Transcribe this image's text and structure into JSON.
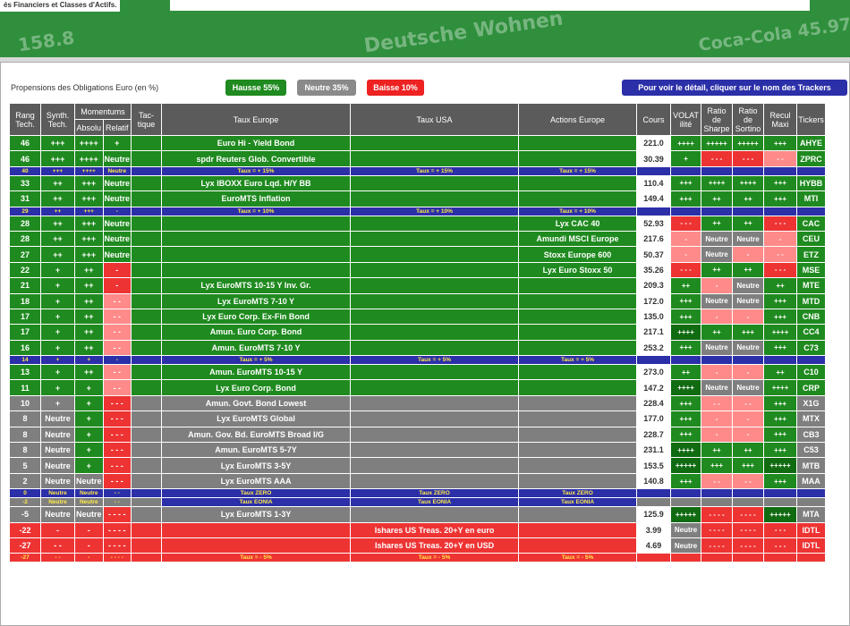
{
  "banner": {
    "subtitle": "és Financiers et Classes d'Actifs.",
    "ghost_items": [
      "Deutsche Wohnen",
      "Coca-Cola 45.97",
      "158.8"
    ]
  },
  "toolbar": {
    "title": "Propensions des Obligations Euro (en %)",
    "hausse": "Hausse 55%",
    "neutre": "Neutre 35%",
    "baisse": "Baisse 10%",
    "detail": "Pour voir le détail, cliquer sur le nom des Trackers"
  },
  "colors": {
    "g": "#1f8a1f",
    "gray": "#7f7f7f",
    "red": "#ee3333",
    "blue": "#2b2fa8",
    "header": "#5b5b5b"
  },
  "headers": {
    "rang": "Rang Tech.",
    "synth": "Synth. Tech.",
    "momentums": "Momentums",
    "absolu": "Absolu",
    "relatif": "Relatif",
    "tactique": "Tac- tique",
    "taux_europe": "Taux Europe",
    "taux_usa": "Taux USA",
    "actions": "Actions Europe",
    "cours": "Cours",
    "volat": "VOLAT ilité",
    "sharpe": "Ratio de Sharpe",
    "sortino": "Ratio de Sortino",
    "recul": "Recul Maxi",
    "tickers": "Tickers"
  },
  "rows": [
    {
      "c": [
        "46",
        "+++",
        "++++",
        "+",
        "",
        "Euro Hi - Yield Bond",
        "",
        "",
        "221.0",
        "++++",
        "+++++",
        "+++++",
        "+++",
        "AHYE"
      ],
      "k": [
        "g",
        "g",
        "g",
        "g",
        "g",
        "g",
        "g",
        "g",
        "w",
        "g",
        "g",
        "g",
        "g",
        "g"
      ]
    },
    {
      "c": [
        "46",
        "+++",
        "++++",
        "Neutre",
        "",
        "spdr Reuters Glob. Convertible",
        "",
        "",
        "30.39",
        "+",
        "- - -",
        "- - -",
        "- -",
        "ZPRC"
      ],
      "k": [
        "g",
        "g",
        "g",
        "g",
        "g",
        "g",
        "g",
        "g",
        "w",
        "g",
        "r",
        "r",
        "pr",
        "g"
      ]
    },
    {
      "s": 1,
      "c": [
        "40",
        "+++",
        "++++",
        "Neutre",
        "",
        "Taux = + 15%",
        "Taux = + 15%",
        "Taux = + 15%",
        "",
        "",
        "",
        "",
        "",
        ""
      ]
    },
    {
      "c": [
        "33",
        "++",
        "+++",
        "Neutre",
        "",
        "Lyx IBOXX Euro Lqd. H/Y BB",
        "",
        "",
        "110.4",
        "+++",
        "++++",
        "++++",
        "+++",
        "HYBB"
      ],
      "k": [
        "g",
        "g",
        "g",
        "g",
        "g",
        "g",
        "g",
        "g",
        "w",
        "g",
        "g",
        "g",
        "g",
        "g"
      ]
    },
    {
      "c": [
        "31",
        "++",
        "+++",
        "Neutre",
        "",
        "EuroMTS Inflation",
        "",
        "",
        "149.4",
        "+++",
        "++",
        "++",
        "+++",
        "MTI"
      ],
      "k": [
        "g",
        "g",
        "g",
        "g",
        "g",
        "g",
        "g",
        "g",
        "w",
        "g",
        "g",
        "g",
        "g",
        "g"
      ]
    },
    {
      "s": 1,
      "c": [
        "29",
        "++",
        "+++",
        "-",
        "",
        "Taux = + 10%",
        "Taux = + 10%",
        "Taux = + 10%",
        "",
        "",
        "",
        "",
        "",
        ""
      ]
    },
    {
      "c": [
        "28",
        "++",
        "+++",
        "Neutre",
        "",
        "",
        "",
        "Lyx CAC 40",
        "52.93",
        "- - -",
        "++",
        "++",
        "- - -",
        "CAC"
      ],
      "k": [
        "g",
        "g",
        "g",
        "g",
        "g",
        "g",
        "g",
        "g",
        "w",
        "r",
        "g",
        "g",
        "r",
        "g"
      ]
    },
    {
      "c": [
        "28",
        "++",
        "+++",
        "Neutre",
        "",
        "",
        "",
        "Amundi MSCI Europe",
        "217.6",
        "-",
        "Neutre",
        "Neutre",
        "-",
        "CEU"
      ],
      "k": [
        "g",
        "g",
        "g",
        "g",
        "g",
        "g",
        "g",
        "g",
        "w",
        "pr",
        "gr",
        "gr",
        "pr",
        "g"
      ]
    },
    {
      "c": [
        "27",
        "++",
        "+++",
        "Neutre",
        "",
        "",
        "",
        "Stoxx Europe 600",
        "50.37",
        "-",
        "Neutre",
        "-",
        "- -",
        "ETZ"
      ],
      "k": [
        "g",
        "g",
        "g",
        "g",
        "g",
        "g",
        "g",
        "g",
        "w",
        "pr",
        "gr",
        "pr",
        "pr",
        "g"
      ]
    },
    {
      "c": [
        "22",
        "+",
        "++",
        "-",
        "",
        "",
        "",
        "Lyx Euro Stoxx 50",
        "35.26",
        "- - -",
        "++",
        "++",
        "- - -",
        "MSE"
      ],
      "k": [
        "g",
        "g",
        "g",
        "r",
        "g",
        "g",
        "g",
        "g",
        "w",
        "r",
        "g",
        "g",
        "r",
        "g"
      ]
    },
    {
      "c": [
        "21",
        "+",
        "++",
        "-",
        "",
        "Lyx EuroMTS 10-15 Y Inv. Gr.",
        "",
        "",
        "209.3",
        "++",
        "-",
        "Neutre",
        "++",
        "MTE"
      ],
      "k": [
        "g",
        "g",
        "g",
        "r",
        "g",
        "g",
        "g",
        "g",
        "w",
        "g",
        "pr",
        "gr",
        "g",
        "g"
      ]
    },
    {
      "c": [
        "18",
        "+",
        "++",
        "- -",
        "",
        "Lyx EuroMTS 7-10 Y",
        "",
        "",
        "172.0",
        "+++",
        "Neutre",
        "Neutre",
        "+++",
        "MTD"
      ],
      "k": [
        "g",
        "g",
        "g",
        "pr",
        "g",
        "g",
        "g",
        "g",
        "w",
        "g",
        "gr",
        "gr",
        "g",
        "g"
      ]
    },
    {
      "c": [
        "17",
        "+",
        "++",
        "- -",
        "",
        "Lyx Euro Corp. Ex-Fin Bond",
        "",
        "",
        "135.0",
        "+++",
        "-",
        "-",
        "+++",
        "CNB"
      ],
      "k": [
        "g",
        "g",
        "g",
        "pr",
        "g",
        "g",
        "g",
        "g",
        "w",
        "g",
        "pr",
        "pr",
        "g",
        "g"
      ]
    },
    {
      "c": [
        "17",
        "+",
        "++",
        "- -",
        "",
        "Amun. Euro Corp. Bond",
        "",
        "",
        "217.1",
        "++++",
        "++",
        "+++",
        "++++",
        "CC4"
      ],
      "k": [
        "g",
        "g",
        "g",
        "pr",
        "g",
        "g",
        "g",
        "g",
        "w",
        "dg",
        "g",
        "g",
        "g",
        "g"
      ]
    },
    {
      "c": [
        "16",
        "+",
        "++",
        "- -",
        "",
        "Amun. EuroMTS 7-10 Y",
        "",
        "",
        "253.2",
        "+++",
        "Neutre",
        "Neutre",
        "+++",
        "C73"
      ],
      "k": [
        "g",
        "g",
        "g",
        "pr",
        "g",
        "g",
        "g",
        "g",
        "w",
        "g",
        "gr",
        "gr",
        "g",
        "g"
      ]
    },
    {
      "s": 1,
      "c": [
        "14",
        "+",
        "+",
        "-",
        "",
        "Taux = + 5%",
        "Taux = + 5%",
        "Taux = + 5%",
        "",
        "",
        "",
        "",
        "",
        ""
      ]
    },
    {
      "c": [
        "13",
        "+",
        "++",
        "- -",
        "",
        "Amun. EuroMTS 10-15 Y",
        "",
        "",
        "273.0",
        "++",
        "-",
        "-",
        "++",
        "C10"
      ],
      "k": [
        "g",
        "g",
        "g",
        "pr",
        "g",
        "g",
        "g",
        "g",
        "w",
        "g",
        "pr",
        "pr",
        "g",
        "g"
      ]
    },
    {
      "c": [
        "11",
        "+",
        "+",
        "- -",
        "",
        "Lyx Euro Corp. Bond",
        "",
        "",
        "147.2",
        "++++",
        "Neutre",
        "Neutre",
        "++++",
        "CRP"
      ],
      "k": [
        "g",
        "g",
        "g",
        "pr",
        "g",
        "g",
        "g",
        "g",
        "w",
        "dg",
        "gr",
        "gr",
        "g",
        "g"
      ]
    },
    {
      "c": [
        "10",
        "+",
        "+",
        "- - -",
        "",
        "Amun. Govt. Bond Lowest",
        "",
        "",
        "228.4",
        "+++",
        "- -",
        "- -",
        "+++",
        "X1G"
      ],
      "k": [
        "gr",
        "gr",
        "g",
        "r",
        "gr",
        "gr",
        "gr",
        "gr",
        "w",
        "g",
        "pr",
        "pr",
        "g",
        "gr"
      ]
    },
    {
      "c": [
        "8",
        "Neutre",
        "+",
        "- - -",
        "",
        "Lyx EuroMTS Global",
        "",
        "",
        "177.0",
        "+++",
        "-",
        "-",
        "+++",
        "MTX"
      ],
      "k": [
        "gr",
        "gr",
        "g",
        "r",
        "gr",
        "gr",
        "gr",
        "gr",
        "w",
        "g",
        "pr",
        "pr",
        "g",
        "gr"
      ]
    },
    {
      "c": [
        "8",
        "Neutre",
        "+",
        "- - -",
        "",
        "Amun. Gov. Bd. EuroMTS Broad I/G",
        "",
        "",
        "228.7",
        "+++",
        "-",
        "-",
        "+++",
        "CB3"
      ],
      "k": [
        "gr",
        "gr",
        "g",
        "r",
        "gr",
        "gr",
        "gr",
        "gr",
        "w",
        "g",
        "pr",
        "pr",
        "g",
        "gr"
      ]
    },
    {
      "c": [
        "8",
        "Neutre",
        "+",
        "- - -",
        "",
        "Amun. EuroMTS 5-7Y",
        "",
        "",
        "231.1",
        "++++",
        "++",
        "++",
        "+++",
        "C53"
      ],
      "k": [
        "gr",
        "gr",
        "g",
        "r",
        "gr",
        "gr",
        "gr",
        "gr",
        "w",
        "dg",
        "g",
        "g",
        "g",
        "gr"
      ]
    },
    {
      "c": [
        "5",
        "Neutre",
        "+",
        "- - -",
        "",
        "Lyx EuroMTS 3-5Y",
        "",
        "",
        "153.5",
        "+++++",
        "+++",
        "+++",
        "+++++",
        "MTB"
      ],
      "k": [
        "gr",
        "gr",
        "g",
        "r",
        "gr",
        "gr",
        "gr",
        "gr",
        "w",
        "dg",
        "g",
        "g",
        "dg",
        "gr"
      ]
    },
    {
      "c": [
        "2",
        "Neutre",
        "Neutre",
        "- - -",
        "",
        "Lyx EuroMTS AAA",
        "",
        "",
        "140.8",
        "+++",
        "- -",
        "- -",
        "+++",
        "MAA"
      ],
      "k": [
        "gr",
        "gr",
        "gr",
        "r",
        "gr",
        "gr",
        "gr",
        "gr",
        "w",
        "g",
        "pr",
        "pr",
        "g",
        "gr"
      ]
    },
    {
      "s": 1,
      "c": [
        "0",
        "Neutre",
        "Neutre",
        "- -",
        "",
        "Taux ZERO",
        "Taux ZERO",
        "Taux ZERO",
        "",
        "",
        "",
        "",
        "",
        ""
      ]
    },
    {
      "s": 2,
      "c": [
        "-2",
        "Neutre",
        "Neutre",
        "- -",
        "",
        "Taux EONIA",
        "Taux EONIA",
        "Taux EONIA",
        "",
        "",
        "",
        "",
        "",
        ""
      ]
    },
    {
      "c": [
        "-5",
        "Neutre",
        "Neutre",
        "- - - -",
        "",
        "Lyx EuroMTS 1-3Y",
        "",
        "",
        "125.9",
        "+++++",
        "- - - -",
        "- - - -",
        "+++++",
        "MTA"
      ],
      "k": [
        "gr",
        "gr",
        "gr",
        "r",
        "gr",
        "gr",
        "gr",
        "gr",
        "w",
        "dg",
        "r",
        "r",
        "dg",
        "gr"
      ]
    },
    {
      "c": [
        "-22",
        "-",
        "-",
        "- - - -",
        "",
        "",
        "Ishares US Treas. 20+Y en euro",
        "",
        "3.99",
        "Neutre",
        "- - - -",
        "- - - -",
        "- - -",
        "IDTL"
      ],
      "k": [
        "r",
        "r",
        "r",
        "r",
        "r",
        "r",
        "r",
        "r",
        "w",
        "gr",
        "r",
        "r",
        "r",
        "r"
      ]
    },
    {
      "c": [
        "-27",
        "- -",
        "-",
        "- - - -",
        "",
        "",
        "Ishares US Treas. 20+Y en USD",
        "",
        "4.69",
        "Neutre",
        "- - - -",
        "- - - -",
        "- - -",
        "IDTL"
      ],
      "k": [
        "r",
        "r",
        "r",
        "r",
        "r",
        "r",
        "r",
        "r",
        "w",
        "gr",
        "r",
        "r",
        "r",
        "r"
      ]
    },
    {
      "s": 3,
      "c": [
        "-27",
        "- -",
        "-",
        "- - - -",
        "",
        "Taux = - 5%",
        "Taux = - 5%",
        "Taux = - 5%",
        "",
        "",
        "",
        "",
        "",
        ""
      ]
    }
  ]
}
